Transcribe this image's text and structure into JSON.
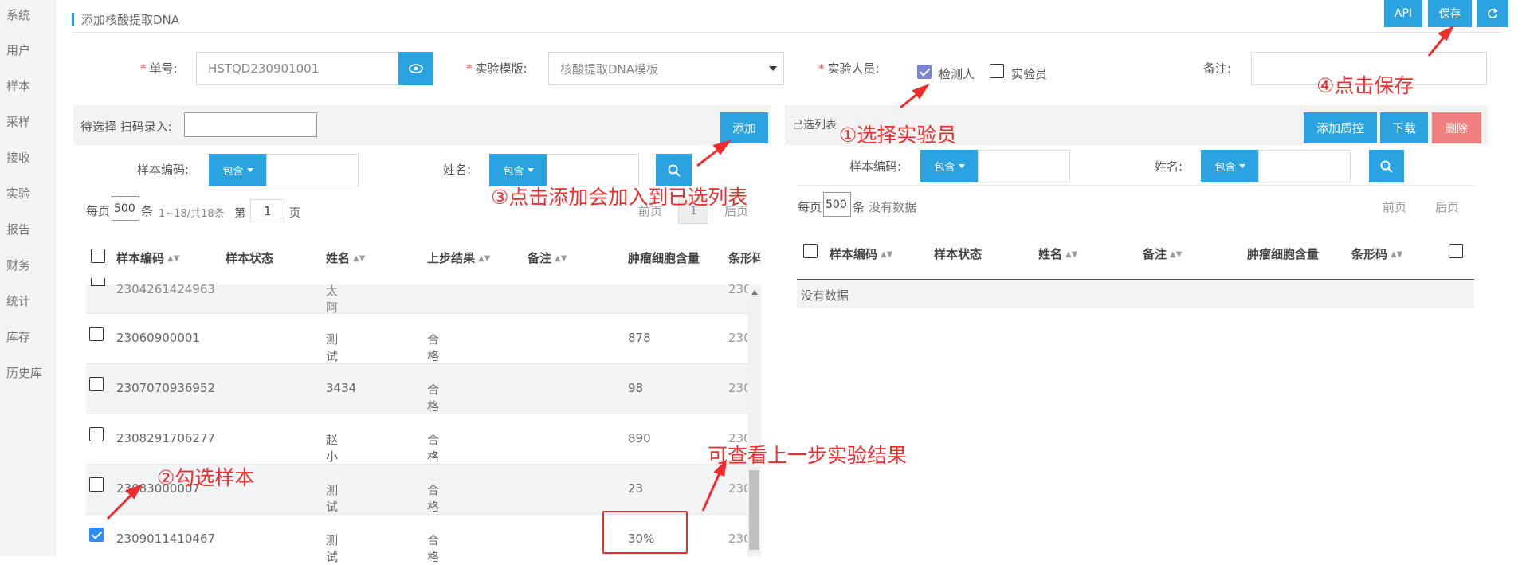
{
  "sidebar": {
    "items": [
      "系统",
      "用户",
      "样本",
      "采样",
      "接收",
      "实验",
      "报告",
      "财务",
      "统计",
      "库存",
      "历史库"
    ]
  },
  "header": {
    "title": "添加核酸提取DNA"
  },
  "toolbar": {
    "api_label": "API",
    "save_label": "保存",
    "refresh_icon": "refresh-icon"
  },
  "form": {
    "order_label": "单号:",
    "order_value": "HSTQD230901001",
    "template_label": "实验模版:",
    "template_value": "核酸提取DNA模板",
    "staff_label": "实验人员:",
    "staff_options": [
      {
        "label": "检测人",
        "checked": true
      },
      {
        "label": "实验员",
        "checked": false
      }
    ],
    "note_label": "备注:",
    "note_value": ""
  },
  "left": {
    "head_label": "待选择 扫码录入:",
    "add_label": "添加",
    "filter_code_label": "样本编码:",
    "filter_name_label": "姓名:",
    "contains_label": "包含",
    "pager": {
      "per_page_label": "每页",
      "per_page_value": "500",
      "unit": "条",
      "range": "1~18/共18条",
      "goto_label": "第",
      "page_value": "1",
      "page_unit": "页",
      "prev": "前页",
      "current": "1",
      "next": "后页"
    },
    "columns": [
      "样本编码",
      "样本状态",
      "姓名",
      "上步结果",
      "备注",
      "肿瘤细胞含量",
      "条形码"
    ],
    "rows": [
      {
        "code": "2304261424963",
        "status": "",
        "name": "太阿",
        "result": "",
        "note": "",
        "tumor": "",
        "barcode": "230",
        "checked": false
      },
      {
        "code": "23060900001",
        "status": "",
        "name": "测试",
        "result": "合格",
        "note": "",
        "tumor": "878",
        "barcode": "230",
        "checked": false
      },
      {
        "code": "2307070936952",
        "status": "",
        "name": "3434",
        "result": "合格",
        "note": "",
        "tumor": "98",
        "barcode": "230",
        "checked": false
      },
      {
        "code": "2308291706277",
        "status": "",
        "name": "赵小紘",
        "result": "合格",
        "note": "",
        "tumor": "890",
        "barcode": "230",
        "checked": false
      },
      {
        "code": "23083000007",
        "status": "",
        "name": "测试",
        "result": "合格",
        "note": "",
        "tumor": "23",
        "barcode": "230",
        "checked": false
      },
      {
        "code": "2309011410467",
        "status": "",
        "name": "测试",
        "result": "合格",
        "note": "",
        "tumor": "30%",
        "barcode": "230",
        "checked": true
      }
    ]
  },
  "right": {
    "head_label": "已选列表",
    "add_qc_label": "添加质控",
    "download_label": "下载",
    "delete_label": "删除",
    "filter_code_label": "样本编码:",
    "filter_name_label": "姓名:",
    "contains_label": "包含",
    "pager": {
      "per_page_label": "每页",
      "per_page_value": "500",
      "unit": "条",
      "empty_label": "没有数据",
      "prev": "前页",
      "next": "后页"
    },
    "columns": [
      "样本编码",
      "样本状态",
      "姓名",
      "备注",
      "肿瘤细胞含量",
      "条形码"
    ],
    "empty_text": "没有数据"
  },
  "annotations": {
    "step1": "①选择实验员",
    "step2": "②勾选样本",
    "step3": "③点击添加会加入到已选列表",
    "step4": "④点击保存",
    "prev_result": "可查看上一步实验结果"
  },
  "colors": {
    "accent": "#2aa3e0",
    "danger": "#f08080",
    "annotation": "#f02d2d"
  }
}
